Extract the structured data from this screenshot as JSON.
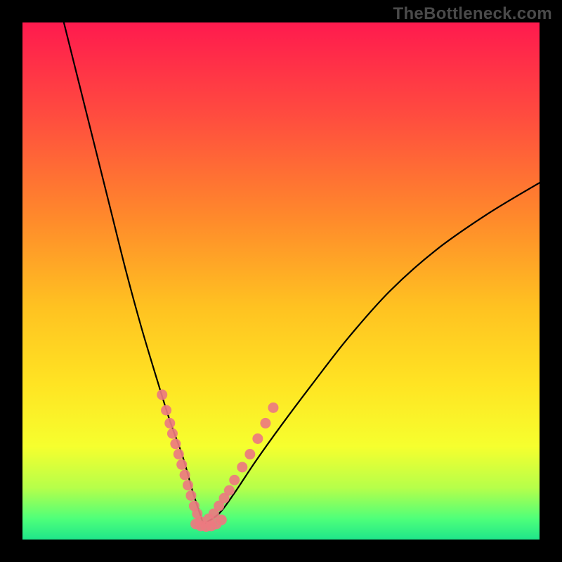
{
  "watermark": "TheBottleneck.com",
  "gradient": {
    "stops": [
      {
        "offset": 0.0,
        "color": "#ff1a4e"
      },
      {
        "offset": 0.18,
        "color": "#ff4c3f"
      },
      {
        "offset": 0.38,
        "color": "#ff8a2b"
      },
      {
        "offset": 0.55,
        "color": "#ffc221"
      },
      {
        "offset": 0.7,
        "color": "#ffe423"
      },
      {
        "offset": 0.82,
        "color": "#f6ff2e"
      },
      {
        "offset": 0.9,
        "color": "#b6ff4a"
      },
      {
        "offset": 0.96,
        "color": "#4eff7a"
      },
      {
        "offset": 1.0,
        "color": "#1fe68a"
      }
    ]
  },
  "chart_data": {
    "type": "line",
    "title": "",
    "xlabel": "",
    "ylabel": "",
    "xlim": [
      0,
      100
    ],
    "ylim": [
      0,
      100
    ],
    "series": [
      {
        "name": "curve-left",
        "x": [
          8,
          11,
          14,
          17,
          20,
          23,
          26,
          28.5,
          31,
          33,
          35
        ],
        "y": [
          100,
          88,
          76,
          64,
          52,
          41,
          31,
          23,
          16,
          9,
          3
        ],
        "dots": false
      },
      {
        "name": "curve-right",
        "x": [
          35,
          38,
          41,
          45,
          50,
          56,
          63,
          71,
          80,
          90,
          100
        ],
        "y": [
          3,
          5,
          9,
          15,
          22,
          30,
          39,
          48,
          56,
          63,
          69
        ],
        "dots": false
      },
      {
        "name": "dots-left",
        "x": [
          27.0,
          27.8,
          28.5,
          29.0,
          29.6,
          30.2,
          30.8,
          31.4,
          32.0,
          32.6,
          33.2,
          33.8,
          34.4
        ],
        "y": [
          28.0,
          25.0,
          22.5,
          20.5,
          18.5,
          16.5,
          14.5,
          12.5,
          10.5,
          8.5,
          6.5,
          5.0,
          3.5
        ],
        "dots": true
      },
      {
        "name": "dots-right",
        "x": [
          36.0,
          37.0,
          38.0,
          39.0,
          40.0,
          41.0,
          42.5,
          44.0,
          45.5,
          47.0,
          48.5
        ],
        "y": [
          4.0,
          5.0,
          6.5,
          8.0,
          9.5,
          11.5,
          14.0,
          16.5,
          19.5,
          22.5,
          25.5
        ],
        "dots": true
      },
      {
        "name": "dots-bottom",
        "x": [
          33.5,
          34.5,
          35.5,
          36.5,
          37.5,
          38.5
        ],
        "y": [
          3.0,
          2.6,
          2.5,
          2.6,
          3.0,
          3.8
        ],
        "dots": true
      }
    ]
  },
  "dot_style": {
    "radius": 7.5,
    "fill": "#eb7a80",
    "opacity": 0.92
  },
  "line_style": {
    "stroke": "#000000",
    "width": 2.2
  }
}
